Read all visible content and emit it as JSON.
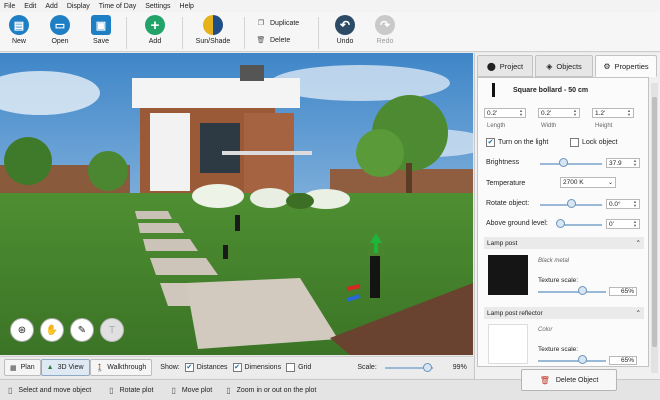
{
  "menu": [
    "File",
    "Edit",
    "Add",
    "Display",
    "Time of Day",
    "Settings",
    "Help"
  ],
  "toolbar": {
    "new": "New",
    "open": "Open",
    "save": "Save",
    "add": "Add",
    "sunshade": "Sun/Shade",
    "duplicate": "Duplicate",
    "delete": "Delete",
    "undo": "Undo",
    "redo": "Redo"
  },
  "bottom": {
    "plan": "Plan",
    "view3d": "3D View",
    "walkthrough": "Walkthrough",
    "show": "Show:",
    "distances": "Distances",
    "dimensions": "Dimensions",
    "grid": "Grid",
    "scale": "Scale:",
    "scale_value": "99%",
    "scale_fraction": 0.99
  },
  "status": {
    "select": "Select and move object",
    "rotate": "Rotate plot",
    "move": "Move plot",
    "zoom": "Zoom in or out on the plot"
  },
  "panel": {
    "tabs": {
      "project": "Project",
      "objects": "Objects",
      "properties": "Properties"
    },
    "object_name": "Square bollard - 50 cm",
    "length_value": "0.2'",
    "width_value": "0.2'",
    "height_value": "1.2'",
    "length_label": "Length",
    "width_label": "Width",
    "height_label": "Height",
    "turn_on_light": "Turn on the light",
    "lock_object": "Lock object",
    "brightness_label": "Brightness",
    "brightness_value": "37.9",
    "brightness_fraction": 0.38,
    "temperature_label": "Temperature",
    "temperature_value": "2700 K",
    "rotate_label": "Rotate object:",
    "rotate_value": "0.0°",
    "rotate_fraction": 0.5,
    "above_label": "Above ground level:",
    "above_value": "0'",
    "above_fraction": 0.0,
    "section1": "Lamp post",
    "material1": "Black metal",
    "texture_label1": "Texture scale:",
    "texture_value1": "65%",
    "texture_fraction1": 0.65,
    "section2": "Lamp post reflector",
    "material2": "Color",
    "texture_label2": "Texture scale:",
    "texture_value2": "65%",
    "texture_fraction2": 0.65,
    "delete_button": "Delete Object"
  },
  "colors": {
    "accent_blue": "#1f7fc4",
    "green_add": "#22a36a",
    "sun": "#e6b21c",
    "black_swatch": "#151515",
    "white_swatch": "#ffffff"
  }
}
